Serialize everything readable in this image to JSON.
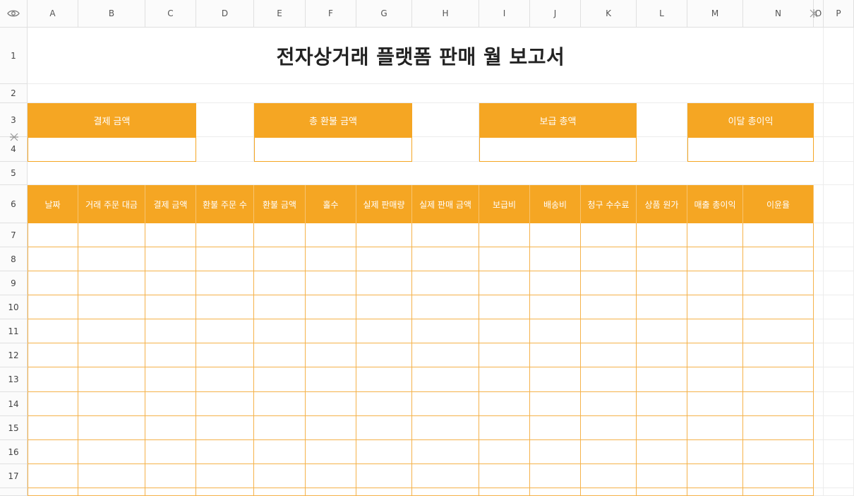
{
  "sheet": {
    "title": "전자상거래 플랫폼 판매 월 보고서",
    "columns": [
      "A",
      "B",
      "C",
      "D",
      "E",
      "F",
      "G",
      "H",
      "I",
      "J",
      "K",
      "L",
      "M",
      "N",
      "O",
      "P"
    ],
    "rows": [
      "1",
      "2",
      "3",
      "4",
      "5",
      "6",
      "7",
      "8",
      "9",
      "10",
      "11",
      "12",
      "13",
      "14",
      "15",
      "16",
      "17"
    ],
    "kpis": [
      {
        "label": "결제 금액",
        "value": ""
      },
      {
        "label": "총 환불 금액",
        "value": ""
      },
      {
        "label": "보급 총액",
        "value": ""
      },
      {
        "label": "이달 총이익",
        "value": ""
      }
    ],
    "table_headers": [
      "날짜",
      "거래 주문 대금",
      "결제 금액",
      "환불 주문 수",
      "환불 금액",
      "홀수",
      "실제 판매량",
      "실제 판매 금액",
      "보급비",
      "배송비",
      "청구 수수료",
      "상품 원가",
      "매출 총이익",
      "이윤율"
    ],
    "data_rows": 11
  },
  "icons": {
    "corner": "eye-icon",
    "freeze_col": "freeze-column-handle-icon",
    "freeze_row": "freeze-row-handle-icon"
  },
  "colors": {
    "accent": "#f5a623",
    "accent_text": "#ffffff",
    "grid": "#ececec"
  }
}
